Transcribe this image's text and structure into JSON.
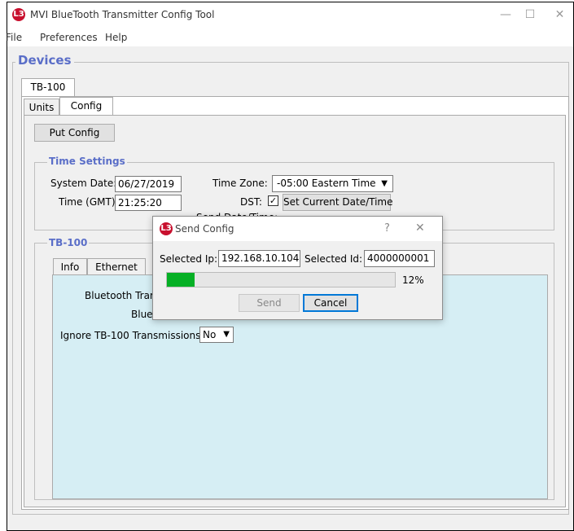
{
  "window": {
    "title": "MVI BlueTooth Transmitter Config Tool"
  },
  "menu": {
    "items": [
      "File",
      "Preferences",
      "Help"
    ]
  },
  "devices": {
    "title": "Devices",
    "device_tab": "TB-100",
    "tabs": [
      "Units",
      "Config"
    ]
  },
  "config": {
    "put_button": "Put Config"
  },
  "time_settings": {
    "title": "Time Settings",
    "system_date_label": "System Date:",
    "system_date_value": "06/27/2019",
    "time_gmt_label": "Time (GMT):",
    "time_gmt_value": "21:25:20",
    "time_zone_label": "Time Zone:",
    "time_zone_value": "-05:00 Eastern Time",
    "dst_label": "DST:",
    "set_current_button": "Set Current Date/Time",
    "send_date_label": "Send Date/Time:"
  },
  "tb100": {
    "title": "TB-100",
    "tabs": [
      "Info",
      "Ethernet"
    ],
    "bt_label_partial": "Bluetooth Trar",
    "blue_partial": "Blue",
    "ignore_label": "Ignore TB-100 Transmissions:",
    "ignore_value": "No"
  },
  "dialog": {
    "title": "Send Config",
    "help": "?",
    "close": "✕",
    "ip_label": "Selected Ip:",
    "ip_value": "192.168.10.104",
    "id_label": "Selected Id:",
    "id_value": "4000000001",
    "progress_percent": 12,
    "progress_text": "12%",
    "send_button": "Send",
    "cancel_button": "Cancel"
  },
  "colors": {
    "accent": "#5a6ec8",
    "progress": "#06b025",
    "panel_bg": "#d6eef4",
    "icon": "#c8102e"
  },
  "icons": {
    "app": "L3",
    "minimize": "—",
    "maximize": "☐",
    "close": "✕",
    "check": "✓",
    "dropdown": "▼"
  }
}
